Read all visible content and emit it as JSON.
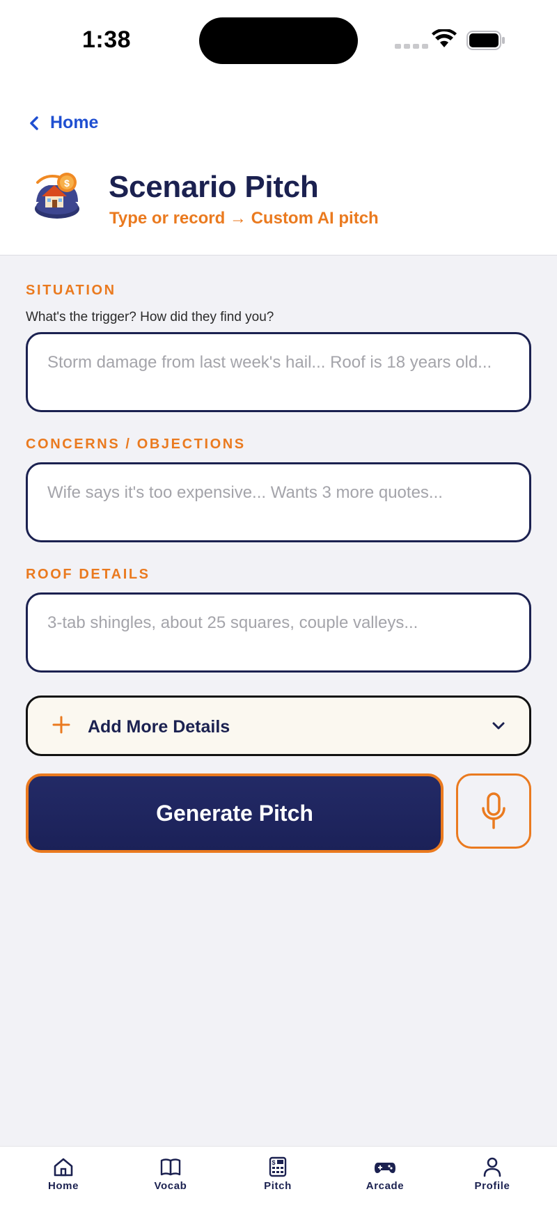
{
  "status_bar": {
    "time": "1:38"
  },
  "nav": {
    "back_label": "Home"
  },
  "header": {
    "title": "Scenario Pitch",
    "subtitle": "Type or record → Custom AI pitch"
  },
  "form": {
    "situation": {
      "label": "SITUATION",
      "hint": "What's the trigger? How did they find you?",
      "placeholder": "Storm damage from last week's hail... Roof is 18 years old...",
      "value": ""
    },
    "concerns": {
      "label": "CONCERNS / OBJECTIONS",
      "placeholder": "Wife says it's too expensive... Wants 3 more quotes...",
      "value": ""
    },
    "roof": {
      "label": "ROOF DETAILS",
      "placeholder": "3-tab shingles, about 25 squares, couple valleys...",
      "value": ""
    },
    "add_more_label": "Add More Details",
    "generate_label": "Generate Pitch"
  },
  "tabs": [
    {
      "label": "Home",
      "icon": "home-icon"
    },
    {
      "label": "Vocab",
      "icon": "book-icon"
    },
    {
      "label": "Pitch",
      "icon": "calculator-icon"
    },
    {
      "label": "Arcade",
      "icon": "gamepad-icon"
    },
    {
      "label": "Profile",
      "icon": "person-icon"
    }
  ],
  "colors": {
    "accent": "#ea7a1f",
    "navy": "#1b2150",
    "link": "#1f4fd1",
    "background": "#f2f2f6"
  }
}
